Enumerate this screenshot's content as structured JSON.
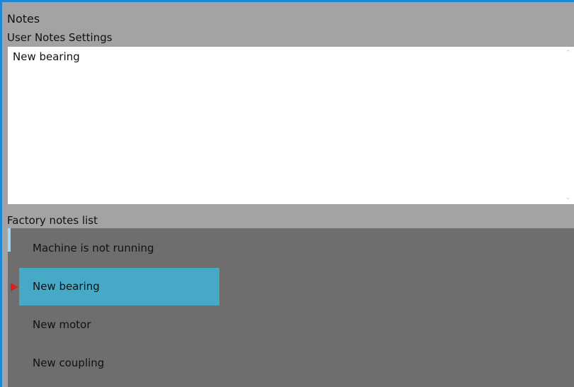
{
  "panel": {
    "title": "Notes",
    "subtitle": "User Notes Settings"
  },
  "editor": {
    "value": "New bearing"
  },
  "factory_list": {
    "label": "Factory notes list",
    "selected_index": 1,
    "items": [
      {
        "label": "Machine is not running"
      },
      {
        "label": "New bearing"
      },
      {
        "label": "New motor"
      },
      {
        "label": "New coupling"
      }
    ]
  },
  "icons": {
    "scroll_up": "chevron-up-icon",
    "scroll_down": "chevron-down-icon",
    "selection_marker": "triangle-right-icon"
  },
  "colors": {
    "frame_accent": "#1e88d8",
    "selected_item": "#46a9c6",
    "list_background": "#6e6e6e",
    "marker": "#d32222"
  }
}
